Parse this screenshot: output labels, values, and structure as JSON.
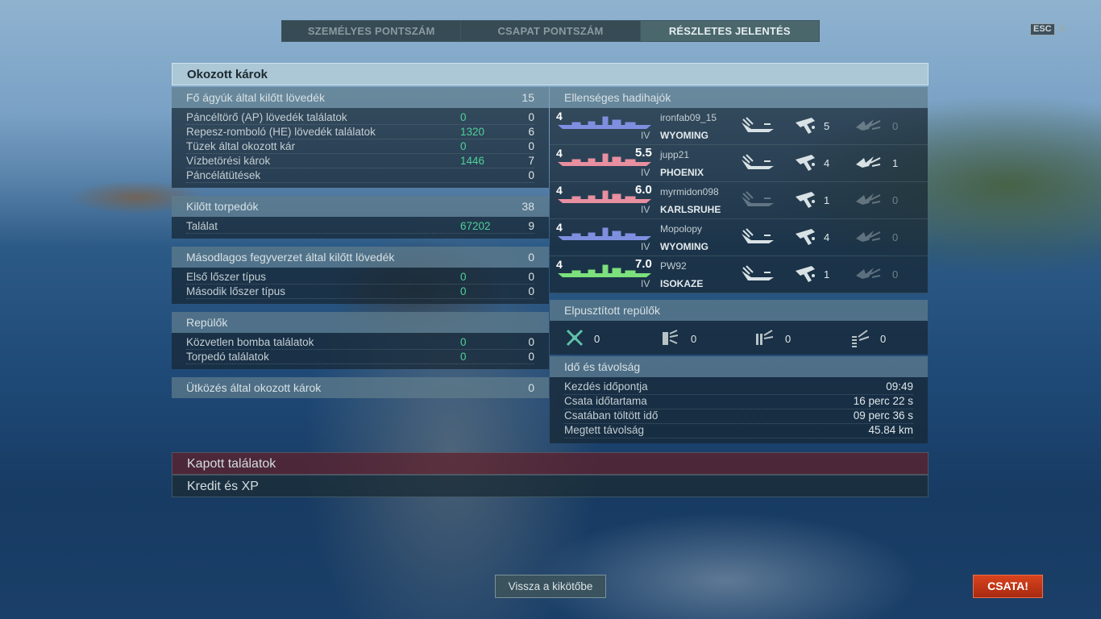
{
  "tabs": [
    {
      "label": "SZEMÉLYES PONTSZÁM",
      "active": false
    },
    {
      "label": "CSAPAT PONTSZÁM",
      "active": false
    },
    {
      "label": "RÉSZLETES JELENTÉS",
      "active": true
    }
  ],
  "esc": {
    "key": "ESC",
    "icon": "close-icon"
  },
  "panel": {
    "title": "Okozott károk"
  },
  "main_guns": {
    "title": "Fő ágyúk által kilőtt lövedék",
    "total": "15",
    "rows": [
      {
        "label": "Páncéltörő (AP) lövedék találatok",
        "damage": "0",
        "hits": "0"
      },
      {
        "label": "Repesz-romboló (HE) lövedék találatok",
        "damage": "1320",
        "hits": "6"
      },
      {
        "label": "Tüzek által okozott kár",
        "damage": "0",
        "hits": "0"
      },
      {
        "label": "Vízbetörési károk",
        "damage": "1446",
        "hits": "7"
      },
      {
        "label": "Páncélátütések",
        "damage": "",
        "hits": "0"
      }
    ]
  },
  "torpedoes": {
    "title": "Kilőtt torpedók",
    "total": "38",
    "rows": [
      {
        "label": "Találat",
        "damage": "67202",
        "hits": "9"
      }
    ]
  },
  "secondary": {
    "title": "Másodlagos fegyverzet által kilőtt lövedék",
    "total": "0",
    "rows": [
      {
        "label": "Első lőszer típus",
        "damage": "0",
        "hits": "0"
      },
      {
        "label": "Második lőszer típus",
        "damage": "0",
        "hits": "0"
      }
    ]
  },
  "aircraft": {
    "title": "Repülők",
    "rows": [
      {
        "label": "Közvetlen bomba találatok",
        "damage": "0",
        "hits": "0"
      },
      {
        "label": "Torpedó találatok",
        "damage": "0",
        "hits": "0"
      }
    ]
  },
  "ramming": {
    "title": "Ütközés által okozott károk",
    "total": "0"
  },
  "enemy_ships": {
    "title": "Ellenséges hadihajók",
    "ships": [
      {
        "tier": "4",
        "roman": "IV",
        "score": "",
        "player": "ironfab09_15",
        "ship": "WYOMING",
        "color": "#7f8fe0",
        "spotted": "",
        "hits": "5",
        "destroyed": "0"
      },
      {
        "tier": "4",
        "roman": "IV",
        "score": "5.5",
        "player": "jupp21",
        "ship": "PHOENIX",
        "color": "#e88fa0",
        "spotted": "",
        "hits": "4",
        "destroyed": "1"
      },
      {
        "tier": "4",
        "roman": "IV",
        "score": "6.0",
        "player": "myrmidon098",
        "ship": "KARLSRUHE",
        "color": "#e88fa0",
        "spotted": "",
        "hits": "1",
        "destroyed": "0"
      },
      {
        "tier": "4",
        "roman": "IV",
        "score": "",
        "player": "Mopolopy",
        "ship": "WYOMING",
        "color": "#7f8fe0",
        "spotted": "",
        "hits": "4",
        "destroyed": "0"
      },
      {
        "tier": "4",
        "roman": "IV",
        "score": "7.0",
        "player": "PW92",
        "ship": "ISOKAZE",
        "color": "#7ce07c",
        "spotted": "",
        "hits": "1",
        "destroyed": "0"
      }
    ]
  },
  "planes_destroyed": {
    "title": "Elpusztított repülők",
    "items": [
      {
        "icon": "fighter-icon",
        "value": "0"
      },
      {
        "icon": "torpedo-bomber-icon",
        "value": "0"
      },
      {
        "icon": "dive-bomber-icon",
        "value": "0"
      },
      {
        "icon": "scout-plane-icon",
        "value": "0"
      }
    ]
  },
  "time_distance": {
    "title": "Idő és távolság",
    "rows": [
      {
        "label": "Kezdés időpontja",
        "value": "09:49"
      },
      {
        "label": "Csata időtartama",
        "value": "16 perc 22 s"
      },
      {
        "label": "Csatában töltött idő",
        "value": "09 perc 36 s"
      },
      {
        "label": "Megtett távolság",
        "value": "45.84 km"
      }
    ]
  },
  "bars": {
    "received": "Kapott találatok",
    "credit": "Kredit és XP"
  },
  "buttons": {
    "back": "Vissza a kikötőbe",
    "battle": "CSATA!"
  }
}
